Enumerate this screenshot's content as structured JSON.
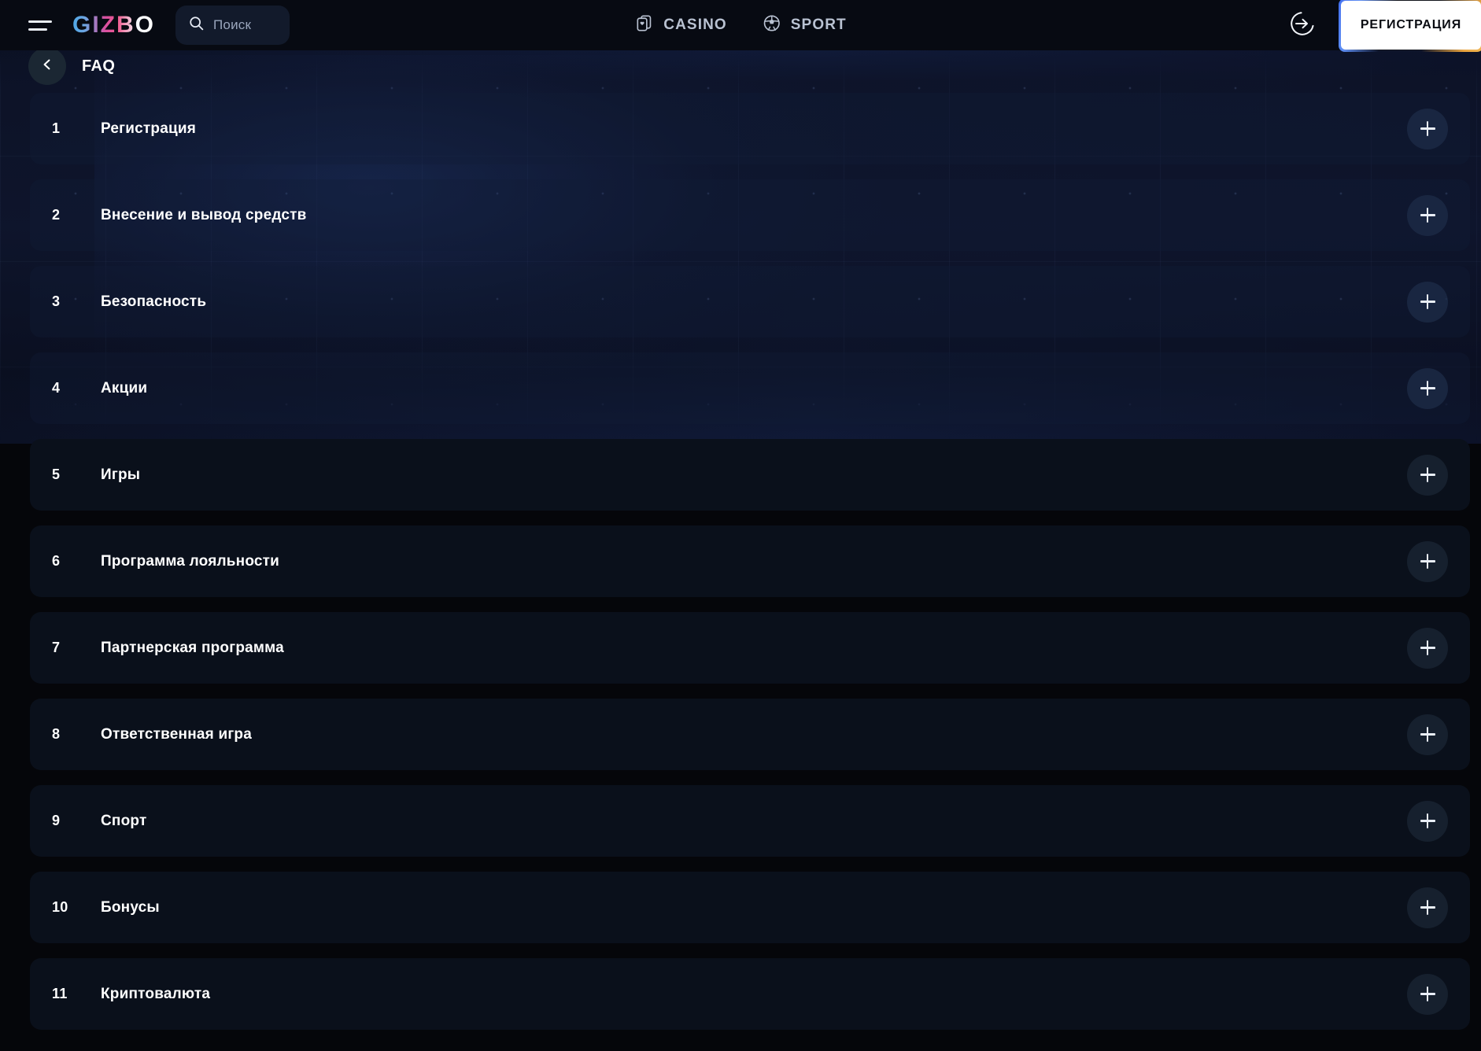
{
  "brand": {
    "name": "GIZBO"
  },
  "topbar": {
    "menu_icon": "hamburger-icon",
    "search": {
      "placeholder": "Поиск",
      "value": "",
      "icon": "search-icon"
    },
    "nav": [
      {
        "label": "CASINO",
        "icon": "cards-icon"
      },
      {
        "label": "SPORT",
        "icon": "soccer-ball-icon"
      }
    ],
    "login": {
      "icon": "login-arrow-icon",
      "label": ""
    },
    "register": {
      "label": "РЕГИСТРАЦИЯ"
    }
  },
  "page": {
    "back_icon": "chevron-left-icon",
    "title": "FAQ"
  },
  "faq": {
    "expand_icon": "plus-icon",
    "items": [
      {
        "num": "1",
        "title": "Регистрация",
        "highlighted": true
      },
      {
        "num": "2",
        "title": "Внесение и вывод средств",
        "highlighted": true
      },
      {
        "num": "3",
        "title": "Безопасность",
        "highlighted": true
      },
      {
        "num": "4",
        "title": "Акции",
        "highlighted": true
      },
      {
        "num": "5",
        "title": "Игры",
        "highlighted": false
      },
      {
        "num": "6",
        "title": "Программа лояльности",
        "highlighted": false
      },
      {
        "num": "7",
        "title": "Партнерская программа",
        "highlighted": false
      },
      {
        "num": "8",
        "title": "Ответственная игра",
        "highlighted": false
      },
      {
        "num": "9",
        "title": "Спорт",
        "highlighted": false
      },
      {
        "num": "10",
        "title": "Бонусы",
        "highlighted": false
      },
      {
        "num": "11",
        "title": "Криптовалюта",
        "highlighted": false
      }
    ]
  },
  "colors": {
    "page_bg": "#05060a",
    "topbar_bg": "#070a12",
    "card_bg": "#0a101b",
    "card_bg_lit": "#121c36",
    "accent_white": "#ffffff",
    "muted_text": "#9aa6bd",
    "nav_text": "#b9c2d2",
    "register_bg": "#ffffff",
    "register_border_left": "#3f6df0",
    "register_border_right": "#e9a23b",
    "logo_gradient_start": "#4da9e8",
    "logo_gradient_mid": "#ee5a8f",
    "logo_gradient_end": "#ffffff"
  }
}
